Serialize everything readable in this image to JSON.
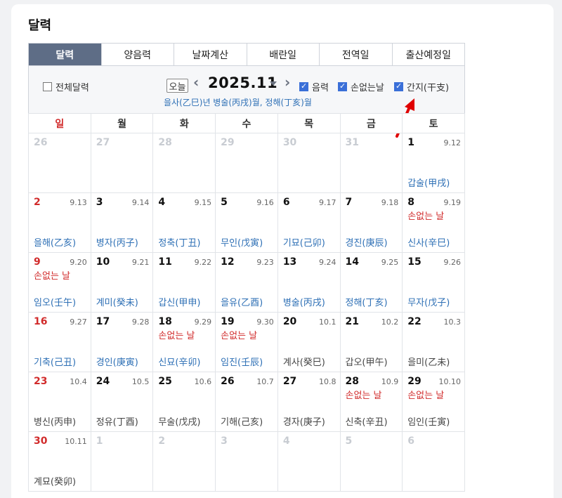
{
  "page": {
    "title": "달력"
  },
  "tabs": [
    {
      "label": "달력",
      "active": true
    },
    {
      "label": "양음력",
      "active": false
    },
    {
      "label": "날짜계산",
      "active": false
    },
    {
      "label": "배란일",
      "active": false
    },
    {
      "label": "전역일",
      "active": false
    },
    {
      "label": "출산예정일",
      "active": false
    }
  ],
  "controls": {
    "full_calendar": "전체달력",
    "today": "오늘",
    "month": "2025.11",
    "lunar": "음력",
    "lucky_day": "손없는날",
    "ganji": "간지(干支)",
    "ganji_line": "을사(乙巳)년 병술(丙戌)월, 정해(丁亥)월"
  },
  "weekdays": [
    "일",
    "월",
    "화",
    "수",
    "목",
    "금",
    "토"
  ],
  "colors": {
    "accent_tab": "#5e6d86",
    "sunday": "#d12b2b",
    "ganji": "#2d6fb5",
    "checkbox": "#3a6fd8",
    "annotation_arrow": "#e00000"
  },
  "weeks": [
    [
      {
        "day": "26",
        "other": true
      },
      {
        "day": "27",
        "other": true
      },
      {
        "day": "28",
        "other": true
      },
      {
        "day": "29",
        "other": true
      },
      {
        "day": "30",
        "other": true
      },
      {
        "day": "31",
        "other": true
      },
      {
        "day": "1",
        "lunar": "9.12",
        "ganji": "갑술(甲戌)"
      }
    ],
    [
      {
        "day": "2",
        "lunar": "9.13",
        "ganji": "을해(乙亥)",
        "sunday": true
      },
      {
        "day": "3",
        "lunar": "9.14",
        "ganji": "병자(丙子)"
      },
      {
        "day": "4",
        "lunar": "9.15",
        "ganji": "정축(丁丑)"
      },
      {
        "day": "5",
        "lunar": "9.16",
        "ganji": "무인(戊寅)"
      },
      {
        "day": "6",
        "lunar": "9.17",
        "ganji": "기묘(己卯)"
      },
      {
        "day": "7",
        "lunar": "9.18",
        "ganji": "경진(庚辰)"
      },
      {
        "day": "8",
        "lunar": "9.19",
        "ganji": "신사(辛巳)",
        "special": "손없는 날"
      }
    ],
    [
      {
        "day": "9",
        "lunar": "9.20",
        "ganji": "임오(壬午)",
        "sunday": true,
        "special": "손없는 날"
      },
      {
        "day": "10",
        "lunar": "9.21",
        "ganji": "계미(癸未)"
      },
      {
        "day": "11",
        "lunar": "9.22",
        "ganji": "갑신(甲申)"
      },
      {
        "day": "12",
        "lunar": "9.23",
        "ganji": "을유(乙酉)"
      },
      {
        "day": "13",
        "lunar": "9.24",
        "ganji": "병술(丙戌)"
      },
      {
        "day": "14",
        "lunar": "9.25",
        "ganji": "정해(丁亥)"
      },
      {
        "day": "15",
        "lunar": "9.26",
        "ganji": "무자(戊子)"
      }
    ],
    [
      {
        "day": "16",
        "lunar": "9.27",
        "ganji": "기축(己丑)",
        "sunday": true
      },
      {
        "day": "17",
        "lunar": "9.28",
        "ganji": "경인(庚寅)"
      },
      {
        "day": "18",
        "lunar": "9.29",
        "ganji": "신묘(辛卯)",
        "special": "손없는 날"
      },
      {
        "day": "19",
        "lunar": "9.30",
        "ganji": "임진(壬辰)",
        "special": "손없는 날"
      },
      {
        "day": "20",
        "lunar": "10.1",
        "ganji": "계사(癸巳)",
        "plain": true
      },
      {
        "day": "21",
        "lunar": "10.2",
        "ganji": "갑오(甲午)",
        "plain": true
      },
      {
        "day": "22",
        "lunar": "10.3",
        "ganji": "을미(乙未)",
        "plain": true
      }
    ],
    [
      {
        "day": "23",
        "lunar": "10.4",
        "ganji": "병신(丙申)",
        "sunday": true,
        "plain": true
      },
      {
        "day": "24",
        "lunar": "10.5",
        "ganji": "정유(丁酉)",
        "plain": true
      },
      {
        "day": "25",
        "lunar": "10.6",
        "ganji": "무술(戊戌)",
        "plain": true
      },
      {
        "day": "26",
        "lunar": "10.7",
        "ganji": "기해(己亥)",
        "plain": true
      },
      {
        "day": "27",
        "lunar": "10.8",
        "ganji": "경자(庚子)",
        "plain": true
      },
      {
        "day": "28",
        "lunar": "10.9",
        "ganji": "신축(辛丑)",
        "special": "손없는 날",
        "plain": true
      },
      {
        "day": "29",
        "lunar": "10.10",
        "ganji": "임인(壬寅)",
        "special": "손없는 날",
        "plain": true
      }
    ],
    [
      {
        "day": "30",
        "lunar": "10.11",
        "ganji": "계묘(癸卯)",
        "sunday": true,
        "plain": true
      },
      {
        "day": "1",
        "other": true
      },
      {
        "day": "2",
        "other": true
      },
      {
        "day": "3",
        "other": true
      },
      {
        "day": "4",
        "other": true
      },
      {
        "day": "5",
        "other": true
      },
      {
        "day": "6",
        "other": true
      }
    ]
  ]
}
